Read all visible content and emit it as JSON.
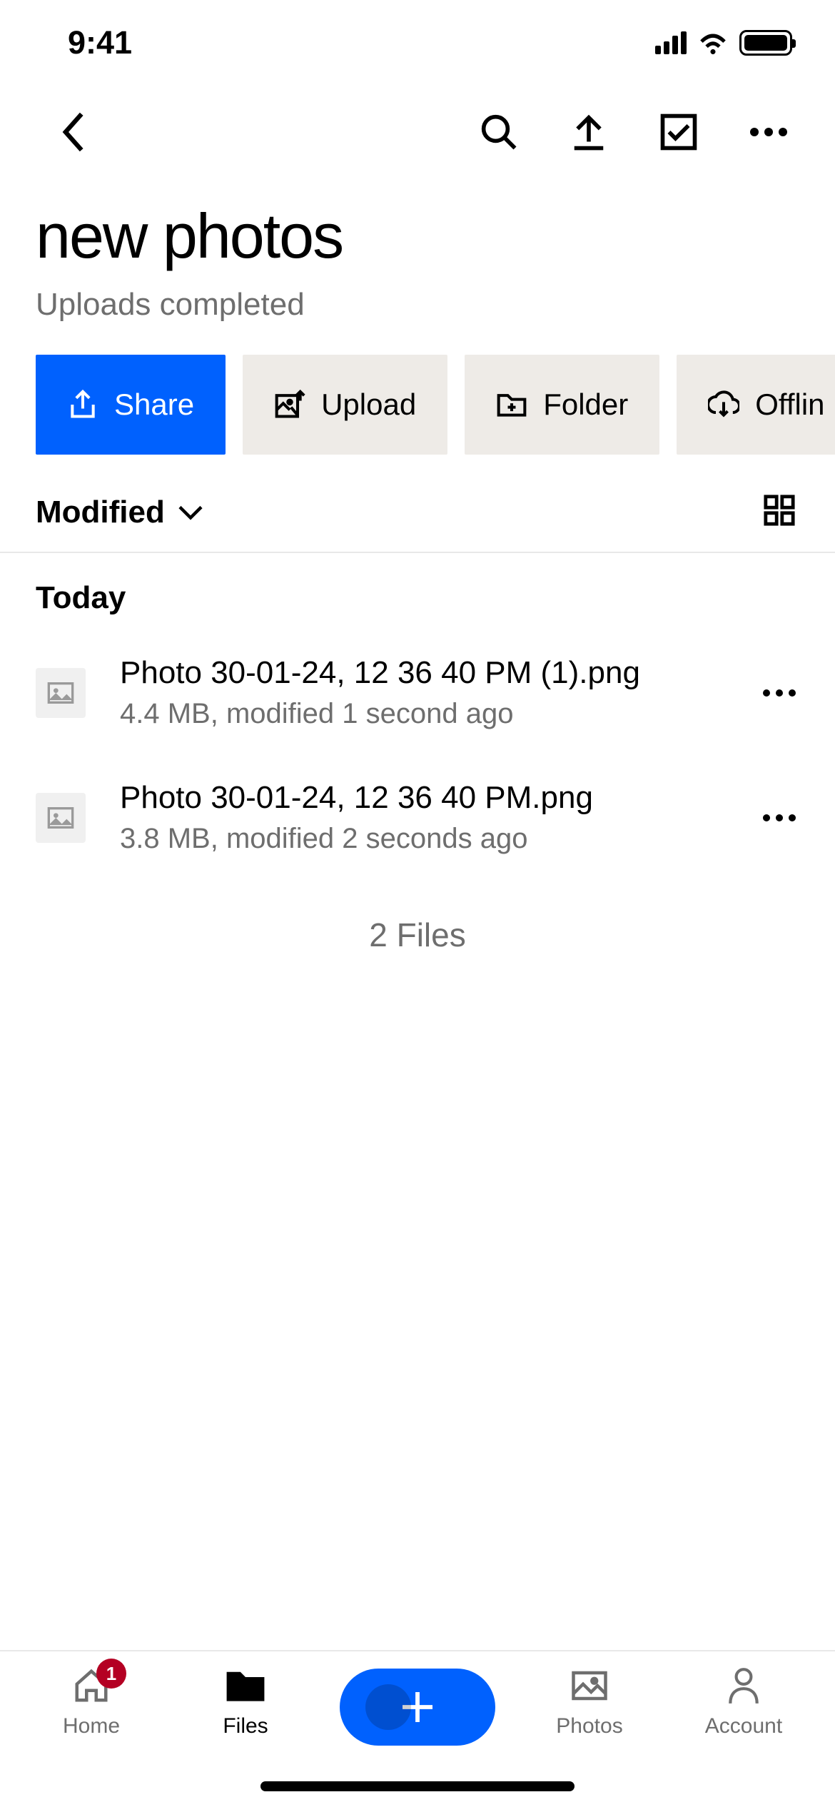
{
  "statusBar": {
    "time": "9:41"
  },
  "folder": {
    "title": "new photos",
    "status": "Uploads completed"
  },
  "actions": {
    "share": "Share",
    "upload": "Upload",
    "folder": "Folder",
    "offline": "Offlin"
  },
  "sort": {
    "label": "Modified"
  },
  "section": {
    "header": "Today"
  },
  "files": [
    {
      "name": "Photo 30-01-24, 12 36 40 PM (1).png",
      "meta": "4.4 MB, modified 1 second ago"
    },
    {
      "name": "Photo 30-01-24, 12 36 40 PM.png",
      "meta": "3.8 MB, modified 2 seconds ago"
    }
  ],
  "count": "2 Files",
  "tabs": {
    "home": "Home",
    "homeBadge": "1",
    "files": "Files",
    "photos": "Photos",
    "account": "Account"
  }
}
